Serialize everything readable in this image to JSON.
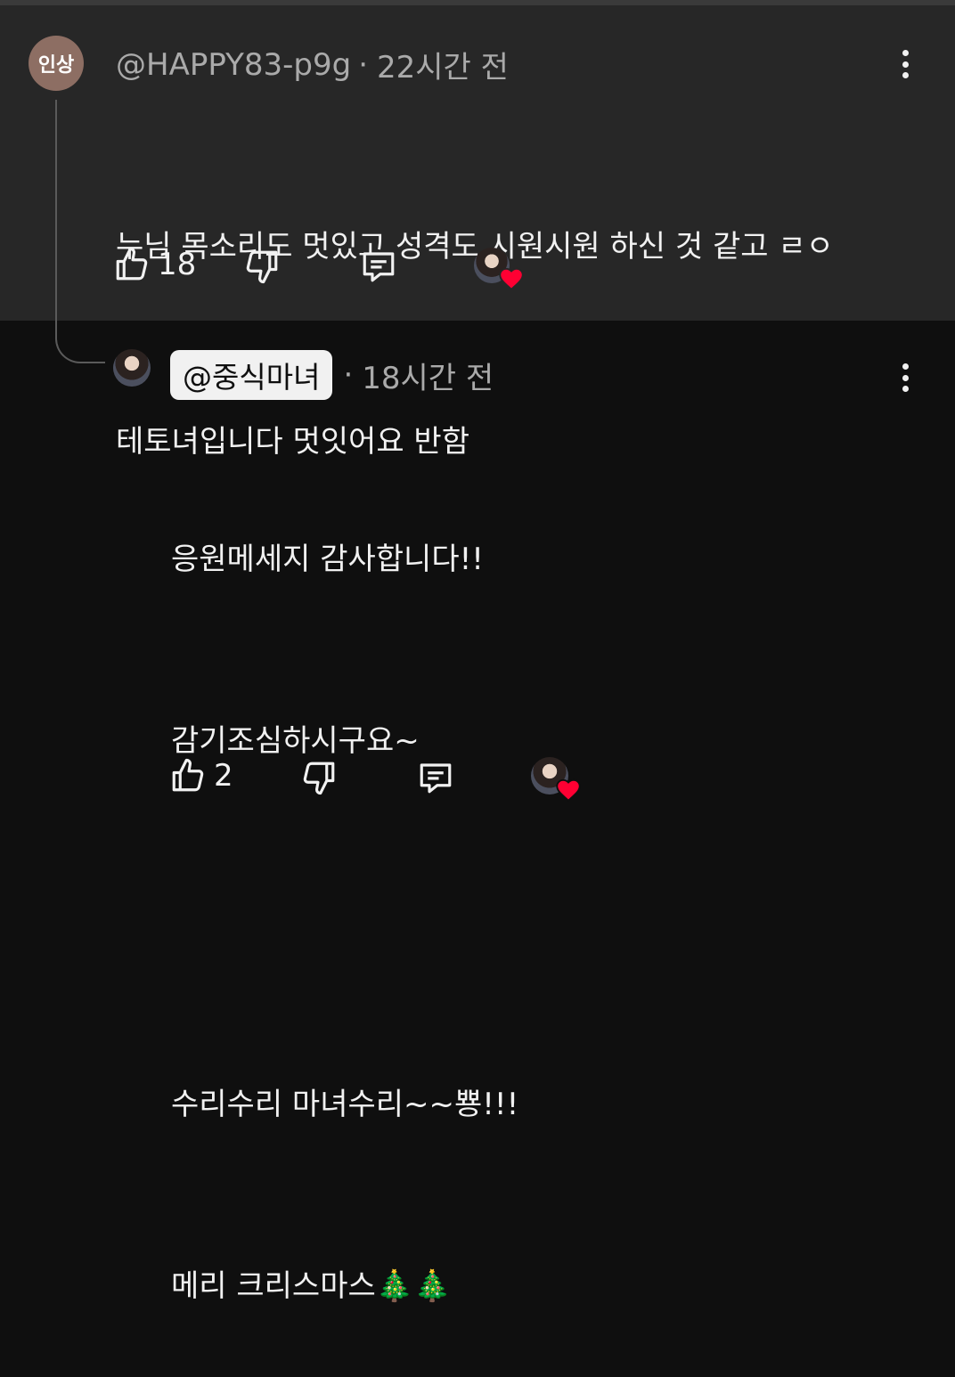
{
  "comment": {
    "avatar_initials": "인상",
    "author": "@HAPPY83-p9g",
    "separator": "·",
    "time": "22시간 전",
    "lines": [
      "누님 목소리도 멋있고 성격도 시원시원 하신 것 같고 ㄹㅇ",
      "테토녀입니다 멋잇어요 반함"
    ],
    "likes": "18"
  },
  "reply": {
    "author": "@중식마녀",
    "separator": "·",
    "time": "18시간 전",
    "lines": [
      "응원메세지 감사합니다!!",
      "감기조심하시구요~",
      "",
      "수리수리 마녀수리~~뿅!!!",
      "메리 크리스마스🎄🎄"
    ],
    "likes": "2"
  },
  "colors": {
    "background": "#0f0f0f",
    "comment_background": "#272727",
    "heart": "#ff0033",
    "avatar": "#8d6e63"
  },
  "icons": [
    "thumb-up-icon",
    "thumb-down-icon",
    "reply-icon",
    "more-vert-icon",
    "creator-heart-icon"
  ]
}
